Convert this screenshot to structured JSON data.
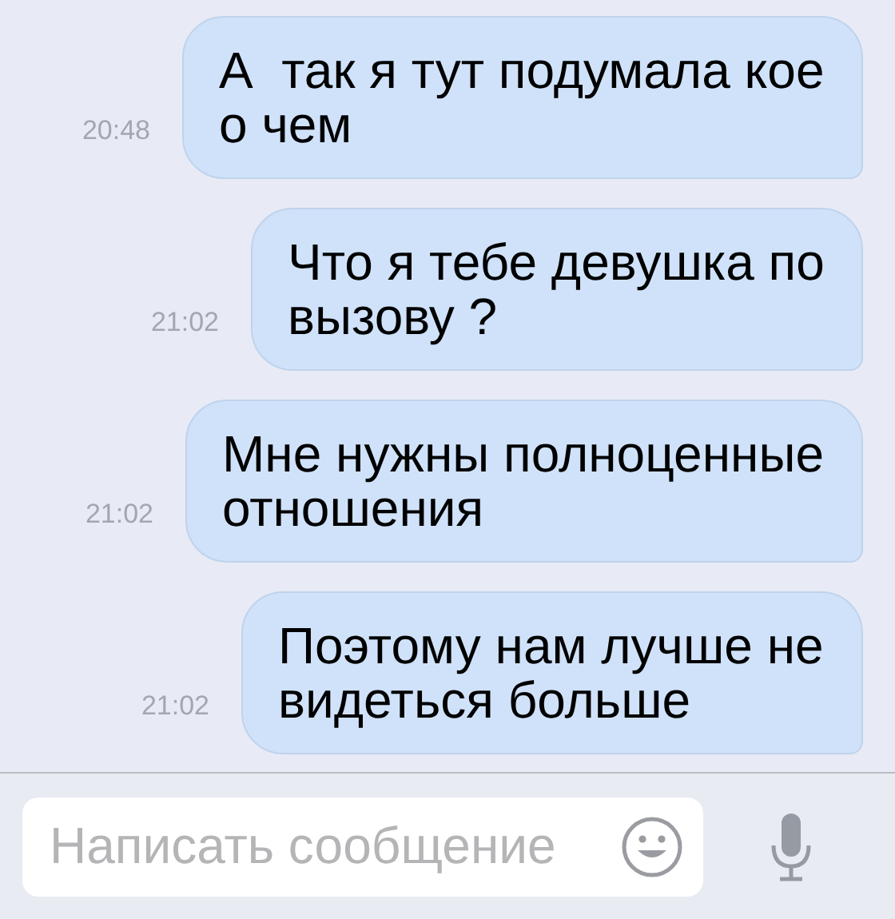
{
  "messages": [
    {
      "text": "А  так я тут подумала кое о чем",
      "time": "20:48"
    },
    {
      "text": "Что я тебе девушка по вызову ?",
      "time": "21:02"
    },
    {
      "text": "Мне нужны полноценные отношения",
      "time": "21:02"
    },
    {
      "text": "Поэтому нам лучше не видеться больше",
      "time": "21:02"
    }
  ],
  "composer": {
    "placeholder": "Написать сообщение"
  }
}
